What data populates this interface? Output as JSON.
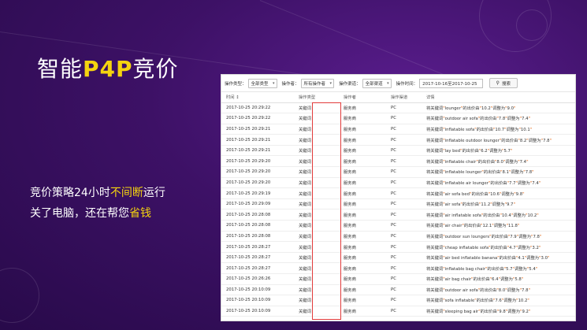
{
  "slide": {
    "title_prefix": "智能",
    "title_accent": "P4P",
    "title_suffix": "竞价",
    "line1_pre": "竞价策略24小时",
    "line1_hl": "不间断",
    "line1_post": "运行",
    "line2_pre": "关了电脑，还在帮您",
    "line2_hl": "省钱",
    "accent_color": "#f5d40f"
  },
  "filters": {
    "type_label": "操作类型：",
    "type_value": "全部类型",
    "operator_label": "操作者：",
    "operator_value": "所有操作者",
    "channel_label": "操作渠道：",
    "channel_value": "全部渠道",
    "time_label": "操作时间：",
    "time_value": "2017-10-16至2017-10-25",
    "search_label": "搜索"
  },
  "table": {
    "headers": [
      "时间 ↕",
      "操作类型",
      "操作者",
      "操作渠道",
      "详情"
    ],
    "rows": [
      {
        "time": "2017-10-25 20:29:22",
        "type": "关键词",
        "op": "服务商",
        "channel": "PC",
        "kw": "lounger",
        "from": "10.2",
        "to": "9.0"
      },
      {
        "time": "2017-10-25 20:29:22",
        "type": "关键词",
        "op": "服务商",
        "channel": "PC",
        "kw": "outdoor air sofa",
        "from": "7.8",
        "to": "7.4"
      },
      {
        "time": "2017-10-25 20:29:21",
        "type": "关键词",
        "op": "服务商",
        "channel": "PC",
        "kw": "inflatable sofa",
        "from": "10.7",
        "to": "10.1"
      },
      {
        "time": "2017-10-25 20:29:21",
        "type": "关键词",
        "op": "服务商",
        "channel": "PC",
        "kw": "inflatable outdoor lounger",
        "from": "8.2",
        "to": "7.8"
      },
      {
        "time": "2017-10-25 20:29:21",
        "type": "关键词",
        "op": "服务商",
        "channel": "PC",
        "kw": "lay bed",
        "from": "6.2",
        "to": "5.7"
      },
      {
        "time": "2017-10-25 20:29:20",
        "type": "关键词",
        "op": "服务商",
        "channel": "PC",
        "kw": "inflatable chair",
        "from": "8.0",
        "to": "7.4"
      },
      {
        "time": "2017-10-25 20:29:20",
        "type": "关键词",
        "op": "服务商",
        "channel": "PC",
        "kw": "inflatable lounger",
        "from": "8.1",
        "to": "7.8"
      },
      {
        "time": "2017-10-25 20:29:20",
        "type": "关键词",
        "op": "服务商",
        "channel": "PC",
        "kw": "inflatable air lounger",
        "from": "7.7",
        "to": "7.4"
      },
      {
        "time": "2017-10-25 20:29:19",
        "type": "关键词",
        "op": "服务商",
        "channel": "PC",
        "kw": "air sofa bed",
        "from": "10.6",
        "to": "9.8"
      },
      {
        "time": "2017-10-25 20:29:09",
        "type": "关键词",
        "op": "服务商",
        "channel": "PC",
        "kw": "air sofa",
        "from": "11.2",
        "to": "9.7"
      },
      {
        "time": "2017-10-25 20:28:08",
        "type": "关键词",
        "op": "服务商",
        "channel": "PC",
        "kw": "air inflatable sofa",
        "from": "10.4",
        "to": "10.2"
      },
      {
        "time": "2017-10-25 20:28:08",
        "type": "关键词",
        "op": "服务商",
        "channel": "PC",
        "kw": "air chair",
        "from": "12.1",
        "to": "11.8"
      },
      {
        "time": "2017-10-25 20:28:08",
        "type": "关键词",
        "op": "服务商",
        "channel": "PC",
        "kw": "outdoor sun loungers",
        "from": "7.9",
        "to": "7.8"
      },
      {
        "time": "2017-10-25 20:28:27",
        "type": "关键词",
        "op": "服务商",
        "channel": "PC",
        "kw": "cheap inflatable sofa",
        "from": "4.7",
        "to": "3.2"
      },
      {
        "time": "2017-10-25 20:28:27",
        "type": "关键词",
        "op": "服务商",
        "channel": "PC",
        "kw": "air bed inflatable banana",
        "from": "4.1",
        "to": "3.0"
      },
      {
        "time": "2017-10-25 20:28:27",
        "type": "关键词",
        "op": "服务商",
        "channel": "PC",
        "kw": "inflatable bag chair",
        "from": "5.7",
        "to": "5.4"
      },
      {
        "time": "2017-10-25 20:26:26",
        "type": "关键词",
        "op": "服务商",
        "channel": "PC",
        "kw": "air bag chair",
        "from": "6.4",
        "to": "5.8"
      },
      {
        "time": "2017-10-25 20:10:09",
        "type": "关键词",
        "op": "服务商",
        "channel": "PC",
        "kw": "outdoor air sofa",
        "from": "8.0",
        "to": "7.8"
      },
      {
        "time": "2017-10-25 20:10:09",
        "type": "关键词",
        "op": "服务商",
        "channel": "PC",
        "kw": "sofa inflatable",
        "from": "7.6",
        "to": "10.2"
      },
      {
        "time": "2017-10-25 20:10:09",
        "type": "关键词",
        "op": "服务商",
        "channel": "PC",
        "kw": "sleeping bag air",
        "from": "9.8",
        "to": "9.2"
      }
    ],
    "detail_tpl": {
      "pre": "将关键词",
      "mid": "的出价由",
      "post": "调整为"
    }
  }
}
